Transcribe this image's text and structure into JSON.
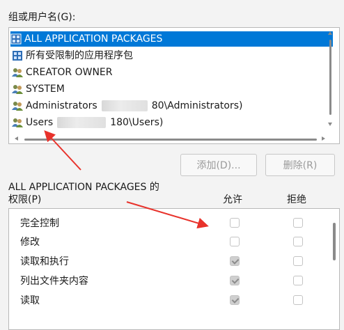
{
  "groups_label": "组或用户名(G):",
  "groups": [
    {
      "name": "ALL APPLICATION PACKAGES",
      "icon": "package-group-icon",
      "selected": true
    },
    {
      "name": "所有受限制的应用程序包",
      "icon": "package-group-icon",
      "selected": false
    },
    {
      "name": "CREATOR OWNER",
      "icon": "users-icon",
      "selected": false
    },
    {
      "name": "SYSTEM",
      "icon": "users-icon",
      "selected": false
    },
    {
      "name_before": "Administrators",
      "name_after": "80\\Administrators)",
      "icon": "users-icon",
      "selected": false
    },
    {
      "name_before": "Users",
      "name_after": "180\\Users)",
      "icon": "users-icon",
      "selected": false
    }
  ],
  "buttons": {
    "add": "添加(D)...",
    "remove": "删除(R)"
  },
  "permissions_title_line1": "ALL APPLICATION PACKAGES 的",
  "permissions_title_line2": "权限(P)",
  "columns": {
    "allow": "允许",
    "deny": "拒绝"
  },
  "permissions": [
    {
      "name": "完全控制",
      "allow": false,
      "deny": false
    },
    {
      "name": "修改",
      "allow": false,
      "deny": false
    },
    {
      "name": "读取和执行",
      "allow": true,
      "deny": false
    },
    {
      "name": "列出文件夹内容",
      "allow": true,
      "deny": false
    },
    {
      "name": "读取",
      "allow": true,
      "deny": false
    }
  ],
  "colors": {
    "selection": "#0078d7",
    "annotation_arrow": "#e8322b"
  }
}
